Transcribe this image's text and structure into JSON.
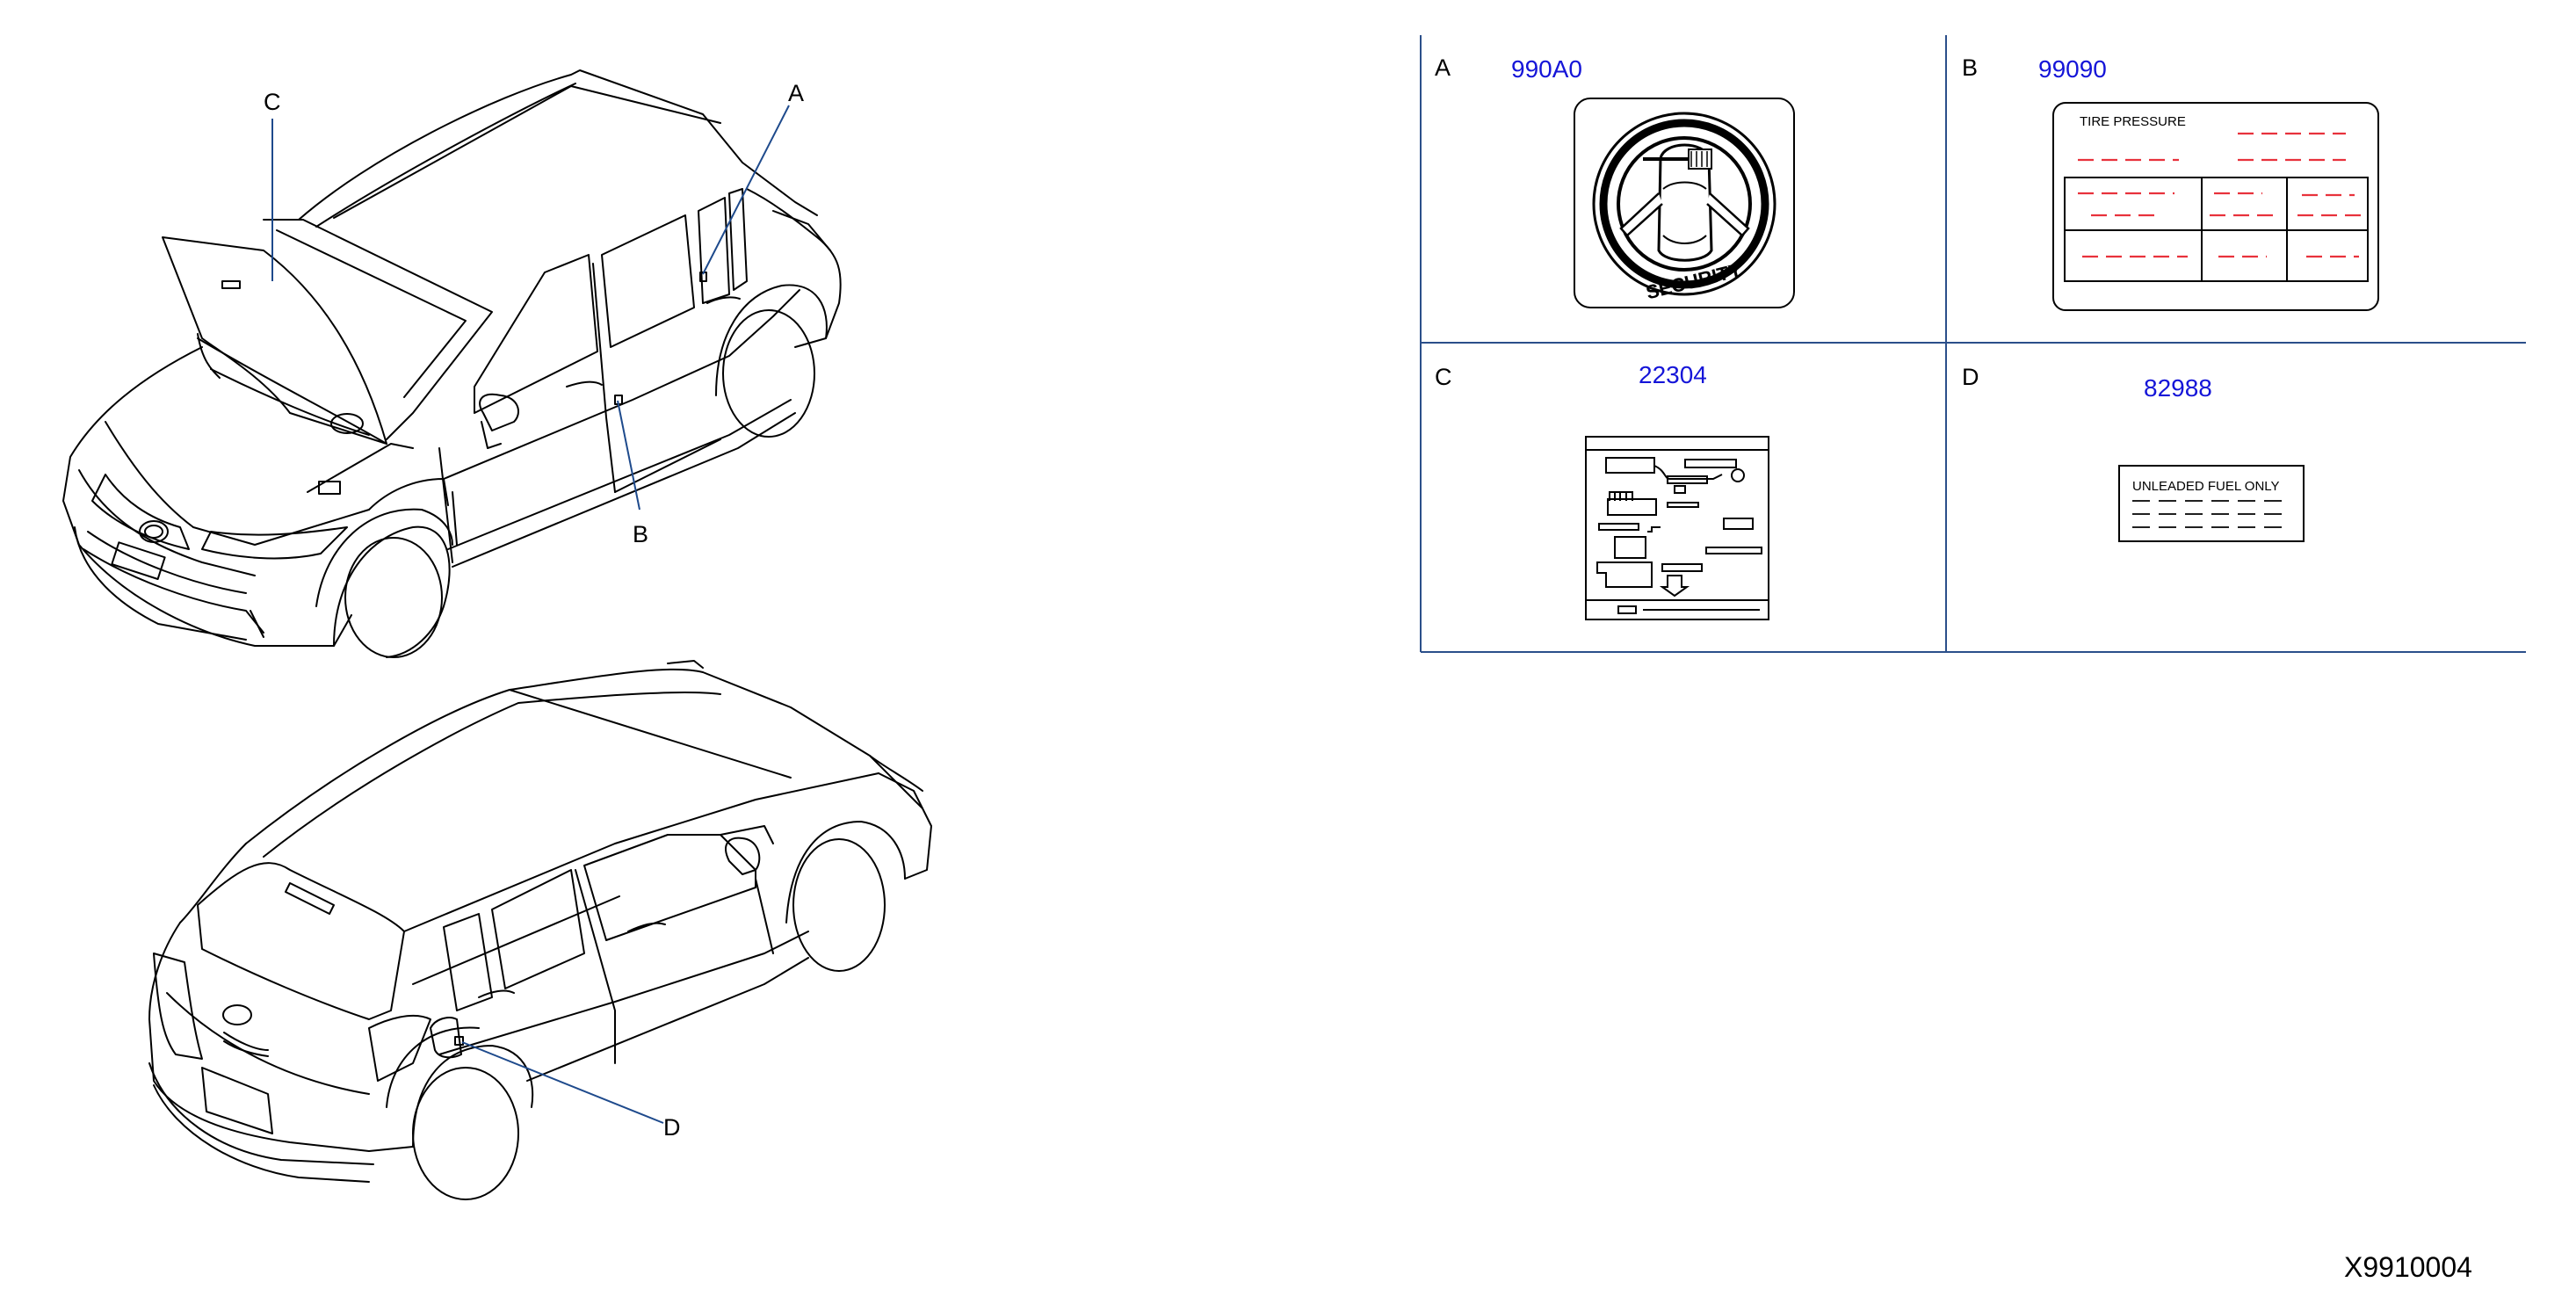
{
  "diagram": {
    "callouts": {
      "a": "A",
      "b": "B",
      "c": "C",
      "d": "D"
    },
    "panels": [
      {
        "letter": "A",
        "part_number": "990A0",
        "label_text": "SECURITY"
      },
      {
        "letter": "B",
        "part_number": "99090",
        "label_text": "TIRE  PRESSURE"
      },
      {
        "letter": "C",
        "part_number": "22304"
      },
      {
        "letter": "D",
        "part_number": "82988",
        "label_text": "UNLEADED  FUEL  ONLY"
      }
    ],
    "reference_code": "X9910004"
  },
  "colors": {
    "part_number": "#1515d8",
    "leader_line": "#1e4a8c",
    "grid_line": "#2b4f8a",
    "placeholder_dash": "#e8323c"
  }
}
